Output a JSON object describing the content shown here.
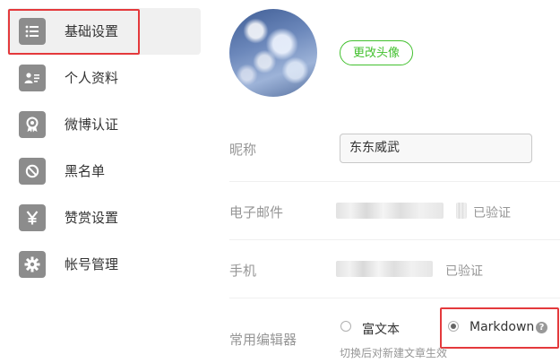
{
  "sidebar": {
    "items": [
      {
        "label": "基础设置",
        "icon": "list-icon",
        "active": true
      },
      {
        "label": "个人资料",
        "icon": "profile-card-icon",
        "active": false
      },
      {
        "label": "微博认证",
        "icon": "badge-icon",
        "active": false
      },
      {
        "label": "黑名单",
        "icon": "block-icon",
        "active": false
      },
      {
        "label": "赞赏设置",
        "icon": "yen-icon",
        "active": false
      },
      {
        "label": "帐号管理",
        "icon": "gear-icon",
        "active": false
      }
    ]
  },
  "main": {
    "change_avatar_label": "更改头像",
    "nickname": {
      "label": "昵称",
      "value": "东东威武"
    },
    "email": {
      "label": "电子邮件",
      "status": "已验证"
    },
    "phone": {
      "label": "手机",
      "status": "已验证"
    },
    "editor": {
      "label": "常用编辑器",
      "options": [
        {
          "label": "富文本",
          "selected": false
        },
        {
          "label": "Markdown",
          "selected": true
        }
      ],
      "hint": "切换后对新建文章生效"
    }
  },
  "colors": {
    "accent": "#42c02e",
    "highlight": "#e4393c",
    "icon_bg": "#8c8c8c"
  }
}
